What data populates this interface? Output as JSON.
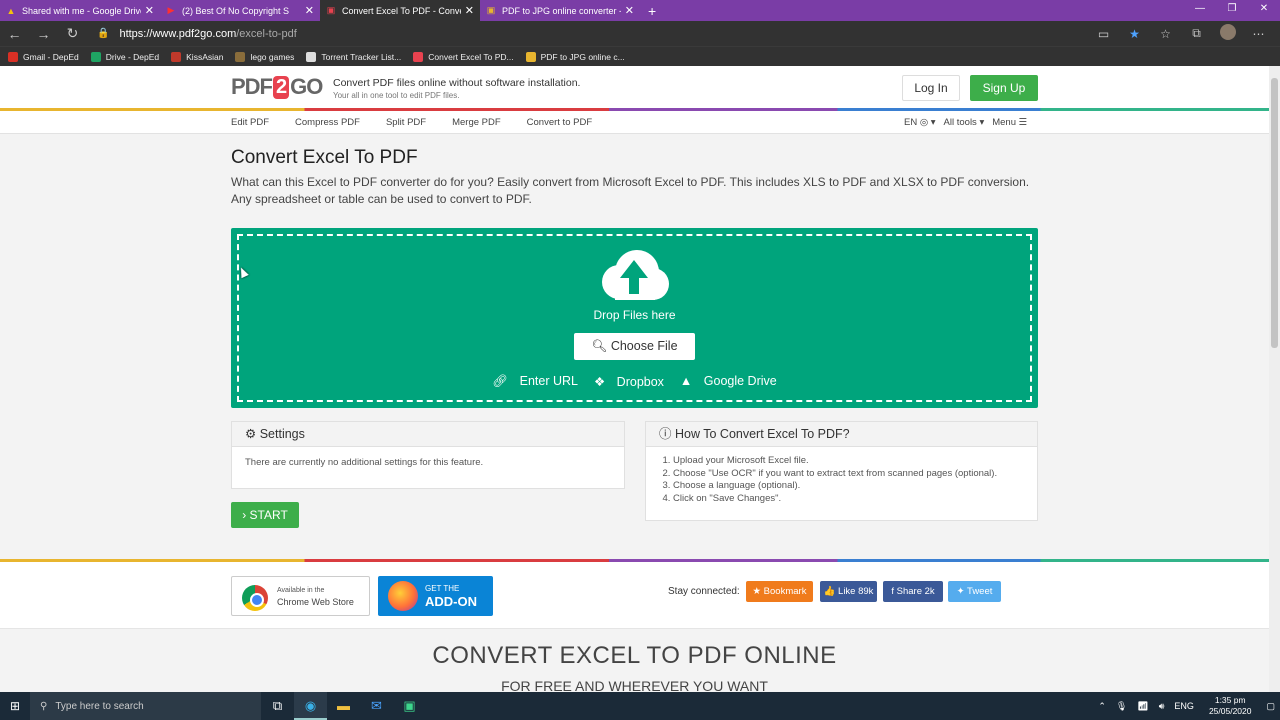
{
  "browser": {
    "tabs": [
      {
        "title": "Shared with me - Google Drive",
        "icon": "drive-icon",
        "active": false
      },
      {
        "title": "(2) Best Of No Copyright S",
        "icon": "youtube-icon",
        "active": false
      },
      {
        "title": "Convert Excel To PDF - Convert y",
        "icon": "pdf2go-icon",
        "active": true
      },
      {
        "title": "PDF to JPG online converter - Co",
        "icon": "pdf2go-icon",
        "active": false
      }
    ],
    "new_tab": "+",
    "url_host": "https://www.pdf2go.com",
    "url_path": "/excel-to-pdf",
    "bookmarks": [
      {
        "label": "Gmail - DepEd",
        "color": "#d93025"
      },
      {
        "label": "Drive - DepEd",
        "color": "#1fa463"
      },
      {
        "label": "KissAsian",
        "color": "#c0392b"
      },
      {
        "label": "lego games",
        "color": "#8a6d3b"
      },
      {
        "label": "Torrent Tracker List...",
        "color": "#555555"
      },
      {
        "label": "Convert Excel To PD...",
        "color": "#e8424f"
      },
      {
        "label": "PDF to JPG online c...",
        "color": "#e8424f"
      }
    ]
  },
  "site": {
    "logo_left": "PDF",
    "logo_two": "2",
    "logo_right": "GO",
    "tagline": "Convert PDF files online without software installation.",
    "tagline_sub": "Your all in one tool to edit PDF files.",
    "login": "Log In",
    "signup": "Sign Up",
    "nav": [
      "Edit PDF",
      "Compress PDF",
      "Split PDF",
      "Merge PDF",
      "Convert to PDF"
    ],
    "nav_right": {
      "lang": "EN ◎ ▾",
      "alltools": "All tools ▾",
      "menu": "Menu ☰"
    }
  },
  "main": {
    "title": "Convert Excel To PDF",
    "description": "What can this Excel to PDF converter do for you? Easily convert from Microsoft Excel to PDF. This includes XLS to PDF and XLSX to PDF conversion. Any spreadsheet or table can be used to convert to PDF.",
    "drop_text": "Drop Files here",
    "choose_file": "Choose File",
    "sources": [
      "Enter URL",
      "Dropbox",
      "Google Drive"
    ],
    "settings_title": "Settings",
    "settings_body": "There are currently no additional settings for this feature.",
    "howto_title": "How To Convert Excel To PDF?",
    "howto_steps": [
      "Upload your Microsoft Excel file.",
      "Choose \"Use OCR\" if you want to extract text from scanned pages (optional).",
      "Choose a language (optional).",
      "Click on \"Save Changes\"."
    ],
    "start": "START"
  },
  "footer": {
    "chrome_small": "Available in the",
    "chrome_big": "Chrome Web Store",
    "ff_small": "GET THE",
    "ff_big": "ADD-ON",
    "stay": "Stay connected:",
    "bookmark": "★ Bookmark",
    "like": "👍 Like 89k",
    "share": "f  Share 2k",
    "tweet": "✦ Tweet",
    "big_title": "CONVERT EXCEL TO PDF ONLINE",
    "subtitle": "FOR FREE AND WHEREVER YOU WANT"
  },
  "taskbar": {
    "search_placeholder": "Type here to search",
    "lang": "ENG",
    "time": "1:35 pm",
    "date": "25/05/2020"
  }
}
